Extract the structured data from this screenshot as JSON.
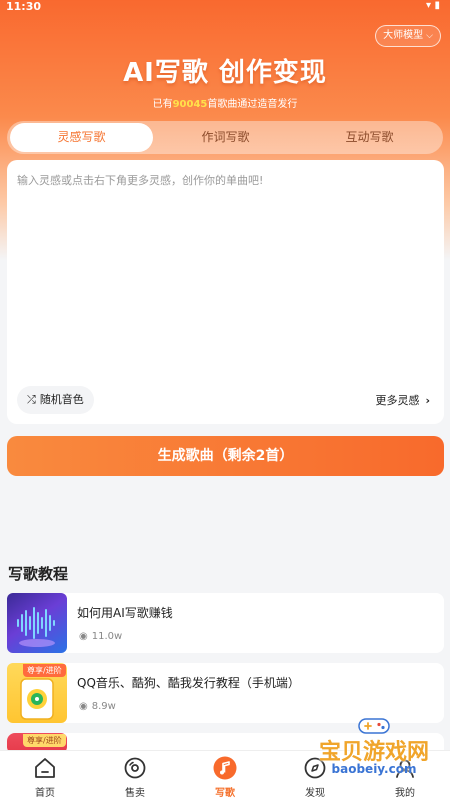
{
  "status_bar": {
    "time": "11:30"
  },
  "header": {
    "model_button_label": "大师模型",
    "title": "AI写歌 创作变现",
    "subtitle_prefix": "已有",
    "subtitle_count": "90045",
    "subtitle_suffix": "首歌曲通过造音发行"
  },
  "tabs": [
    {
      "label": "灵感写歌",
      "active": true
    },
    {
      "label": "作词写歌",
      "active": false
    },
    {
      "label": "互动写歌",
      "active": false
    }
  ],
  "editor": {
    "placeholder": "输入灵感或点击右下角更多灵感，创作你的单曲吧!",
    "random_voice_label": "随机音色",
    "more_inspiration_label": "更多灵感"
  },
  "generate_button_label": "生成歌曲（剩余2首）",
  "tutorials": {
    "section_title": "写歌教程",
    "items": [
      {
        "title": "如何用AI写歌赚钱",
        "views": "11.0w"
      },
      {
        "title": "QQ音乐、酷狗、酷我发行教程（手机端）",
        "views": "8.9w",
        "badge": "尊享/进阶"
      },
      {
        "title": "",
        "views": "",
        "badge": "尊享/进阶"
      }
    ]
  },
  "bottom_nav": [
    {
      "label": "首页",
      "icon": "home-icon",
      "active": false
    },
    {
      "label": "售卖",
      "icon": "disc-icon",
      "active": false
    },
    {
      "label": "写歌",
      "icon": "music-note-icon",
      "active": true
    },
    {
      "label": "发现",
      "icon": "discover-icon",
      "active": false
    },
    {
      "label": "我的",
      "icon": "profile-icon",
      "active": false
    }
  ],
  "watermark": {
    "text": "宝贝游戏网",
    "url": "baobeiy.com"
  },
  "colors": {
    "accent": "#f5732f",
    "hero_top": "#f9692f",
    "highlight": "#ffe14a"
  }
}
